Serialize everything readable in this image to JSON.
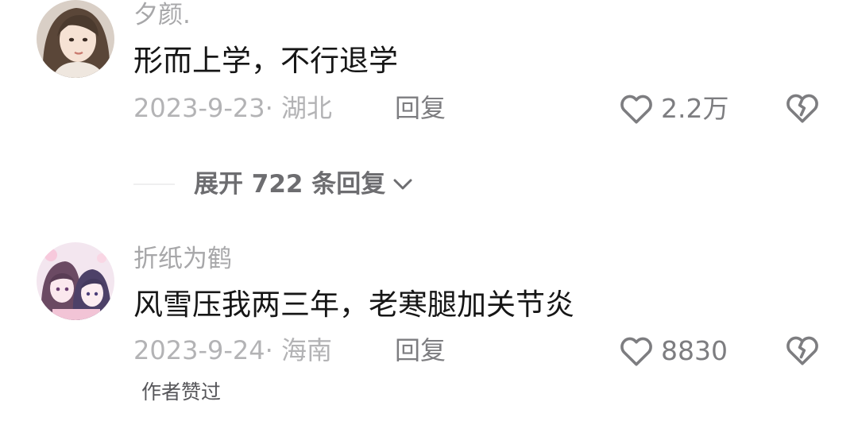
{
  "comments": [
    {
      "username": "夕颜.",
      "text": "形而上学，不行退学",
      "date_location": "2023-9-23· 湖北",
      "reply_label": "回复",
      "like_count": "2.2万",
      "avatar_icon": "user-avatar-woman"
    },
    {
      "username": "折纸为鹤",
      "text": "风雪压我两三年，老寒腿加关节炎",
      "date_location": "2023-9-24· 海南",
      "reply_label": "回复",
      "like_count": "8830",
      "avatar_icon": "user-avatar-anime",
      "author_liked": "作者赞过"
    }
  ],
  "expand_replies": {
    "label": "展开 722 条回复"
  },
  "icons": {
    "like": "heart-outline-icon",
    "dislike": "broken-heart-icon",
    "expand": "chevron-down-icon"
  },
  "colors": {
    "text_primary": "#161616",
    "text_secondary": "#a7a7a9",
    "action_gray": "#7d7d80"
  }
}
